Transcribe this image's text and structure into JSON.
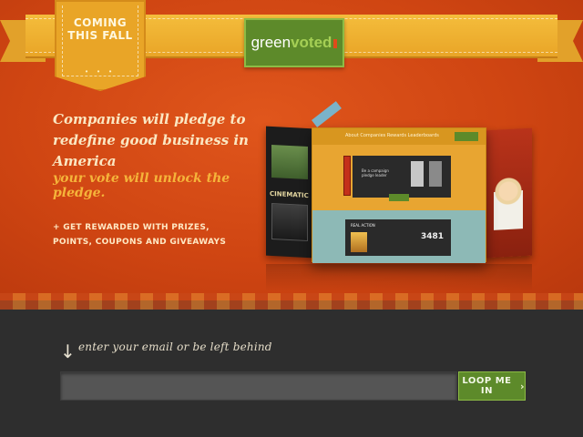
{
  "header": {
    "badge": {
      "line1": "COMING",
      "line2": "THIS FALL",
      "dots": "• • •"
    },
    "logo": {
      "word1": "green",
      "word2": "voted"
    }
  },
  "hero": {
    "headline": "Companies will pledge to redefine good business in America",
    "tagline": "your vote will unlock the pledge.",
    "perks": "+ GET REWARDED WITH PRIZES, POINTS, COUPONS AND GIVEAWAYS"
  },
  "mockup": {
    "side_label": "CINEMATIC",
    "main_nav": "About  Companies  Rewards  Leaderboards",
    "dark_text": "Be a campaign pledge leader",
    "card_label": "REAL ACTION",
    "card_number": "3481"
  },
  "signup": {
    "label": "enter your email or be left behind",
    "input_placeholder": "",
    "input_value": "",
    "button_label": "LOOP ME IN",
    "button_icon": "chevron-right-icon"
  },
  "colors": {
    "hero_orange": "#cf4512",
    "ribbon_yellow": "#e9a527",
    "brand_green": "#5d8a2a",
    "bottom_dark": "#2e2e2e"
  }
}
